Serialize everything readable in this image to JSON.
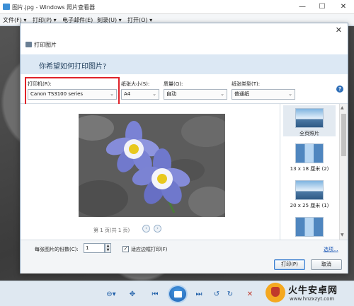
{
  "window": {
    "title": "图片.jpg - Windows 照片查看器",
    "minimize": "—",
    "maximize": "☐",
    "close": "✕"
  },
  "menu": [
    "文件(F) ▾",
    "打印(P) ▾",
    "电子邮件(E)",
    "刻录(U) ▾",
    "打开(O) ▾"
  ],
  "dialog": {
    "title": "打印图片",
    "close": "✕",
    "question": "你希望如何打印图片?",
    "printer": {
      "label": "打印机(R):",
      "value": "Canon TS3100 series"
    },
    "paper_size": {
      "label": "纸张大小(S):",
      "value": "A4"
    },
    "quality": {
      "label": "质量(Q):",
      "value": "自动"
    },
    "paper_type": {
      "label": "纸张类型(T):",
      "value": "普通纸"
    },
    "help": "?",
    "page_indicator": "第 1 页(共 1 页)",
    "layouts": [
      {
        "label": "全页照片",
        "selected": true
      },
      {
        "label": "13 x 18 厘米 (2)",
        "selected": false
      },
      {
        "label": "20 x 25 厘米 (1)",
        "selected": false
      },
      {
        "label": "",
        "selected": false
      }
    ],
    "copies_label": "每张图片的份数(C):",
    "copies_value": "1",
    "fit_label": "适应边框打印(F)",
    "fit_checked": true,
    "options_link": "选项...",
    "print_button": "打印(P)",
    "cancel_button": "取消"
  },
  "watermark": {
    "name": "火牛安卓网",
    "url": "www.hnzxzyt.com"
  },
  "colors": {
    "highlight": "#e0232a",
    "accent": "#1a56b6",
    "band": "#dce8f4"
  }
}
